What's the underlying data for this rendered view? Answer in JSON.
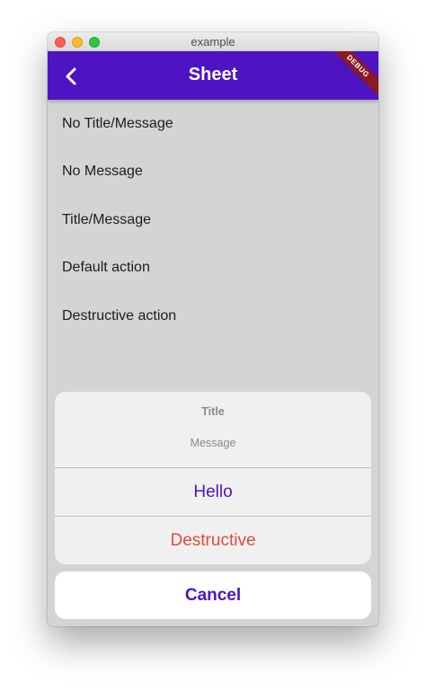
{
  "window": {
    "title": "example"
  },
  "appbar": {
    "title": "Sheet",
    "back_icon": "chevron-left-icon",
    "debug_banner": "DEBUG"
  },
  "list": {
    "items": [
      {
        "label": "No Title/Message"
      },
      {
        "label": "No Message"
      },
      {
        "label": "Title/Message"
      },
      {
        "label": "Default action"
      },
      {
        "label": "Destructive action"
      }
    ]
  },
  "sheet": {
    "title": "Title",
    "message": "Message",
    "actions": [
      {
        "label": "Hello",
        "style": "default"
      },
      {
        "label": "Destructive",
        "style": "destructive"
      }
    ],
    "cancel_label": "Cancel"
  },
  "colors": {
    "primary": "#4f14c1",
    "destructive": "#e04b3a",
    "scrim_background": "#d4d4d4",
    "debug_ribbon": "#8a1b25"
  }
}
